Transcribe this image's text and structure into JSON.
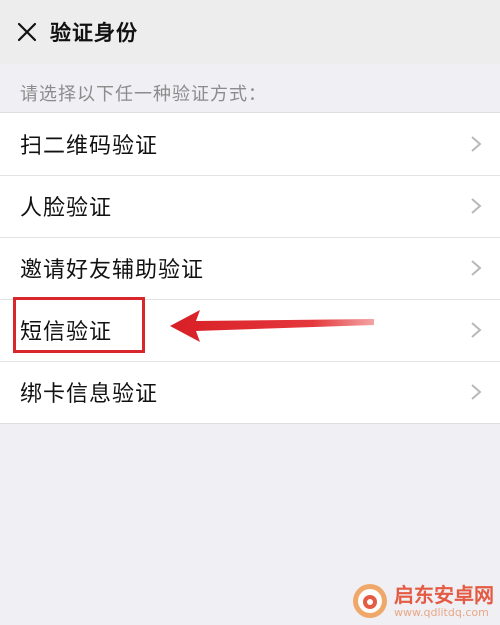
{
  "header": {
    "title": "验证身份",
    "close_icon": "close-icon"
  },
  "hint": "请选择以下任一种验证方式：",
  "items": [
    {
      "label": "扫二维码验证"
    },
    {
      "label": "人脸验证"
    },
    {
      "label": "邀请好友辅助验证"
    },
    {
      "label": "短信验证"
    },
    {
      "label": "绑卡信息验证"
    }
  ],
  "annotation": {
    "box_color": "#d9262a",
    "arrow_color": "#e0272b",
    "arrow_icon": "arrow-left-icon"
  },
  "watermark": {
    "title": "启东安卓网",
    "url": "www.qdlitdq.com",
    "logo_icon": "phone-logo-icon"
  }
}
